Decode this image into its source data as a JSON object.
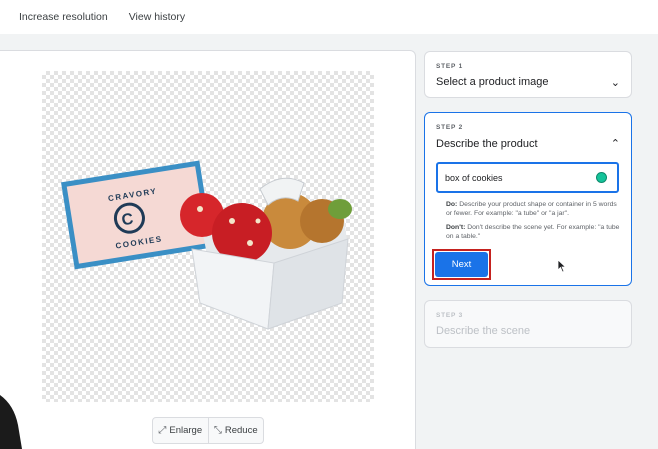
{
  "topbar": {
    "increase_resolution": "Increase resolution",
    "view_history": "View history"
  },
  "product_image": {
    "brand_line1": "CRAVORY",
    "brand_line2": "COOKIES",
    "brand_initial": "C"
  },
  "zoom": {
    "enlarge_label": "Enlarge",
    "reduce_label": "Reduce"
  },
  "steps": {
    "step1": {
      "label": "STEP 1",
      "title": "Select a product image"
    },
    "step2": {
      "label": "STEP 2",
      "title": "Describe the product",
      "input_value": "box of cookies",
      "do_label": "Do:",
      "do_text": " Describe your product shape or container in 5 words or fewer. For example: \"a tube\" or \"a jar\".",
      "dont_label": "Don't:",
      "dont_text": " Don't describe the scene yet. For example: \"a tube on a table.\"",
      "next_label": "Next"
    },
    "step3": {
      "label": "STEP 3",
      "title": "Describe the scene"
    }
  },
  "colors": {
    "accent": "#1a73e8",
    "highlight": "#c5221f",
    "grammarly": "#15c39a"
  },
  "icons": {
    "enlarge": "enlarge-icon",
    "reduce": "reduce-icon",
    "chevron_down": "chevron-down-icon",
    "chevron_up": "chevron-up-icon",
    "grammarly": "grammarly-icon"
  }
}
